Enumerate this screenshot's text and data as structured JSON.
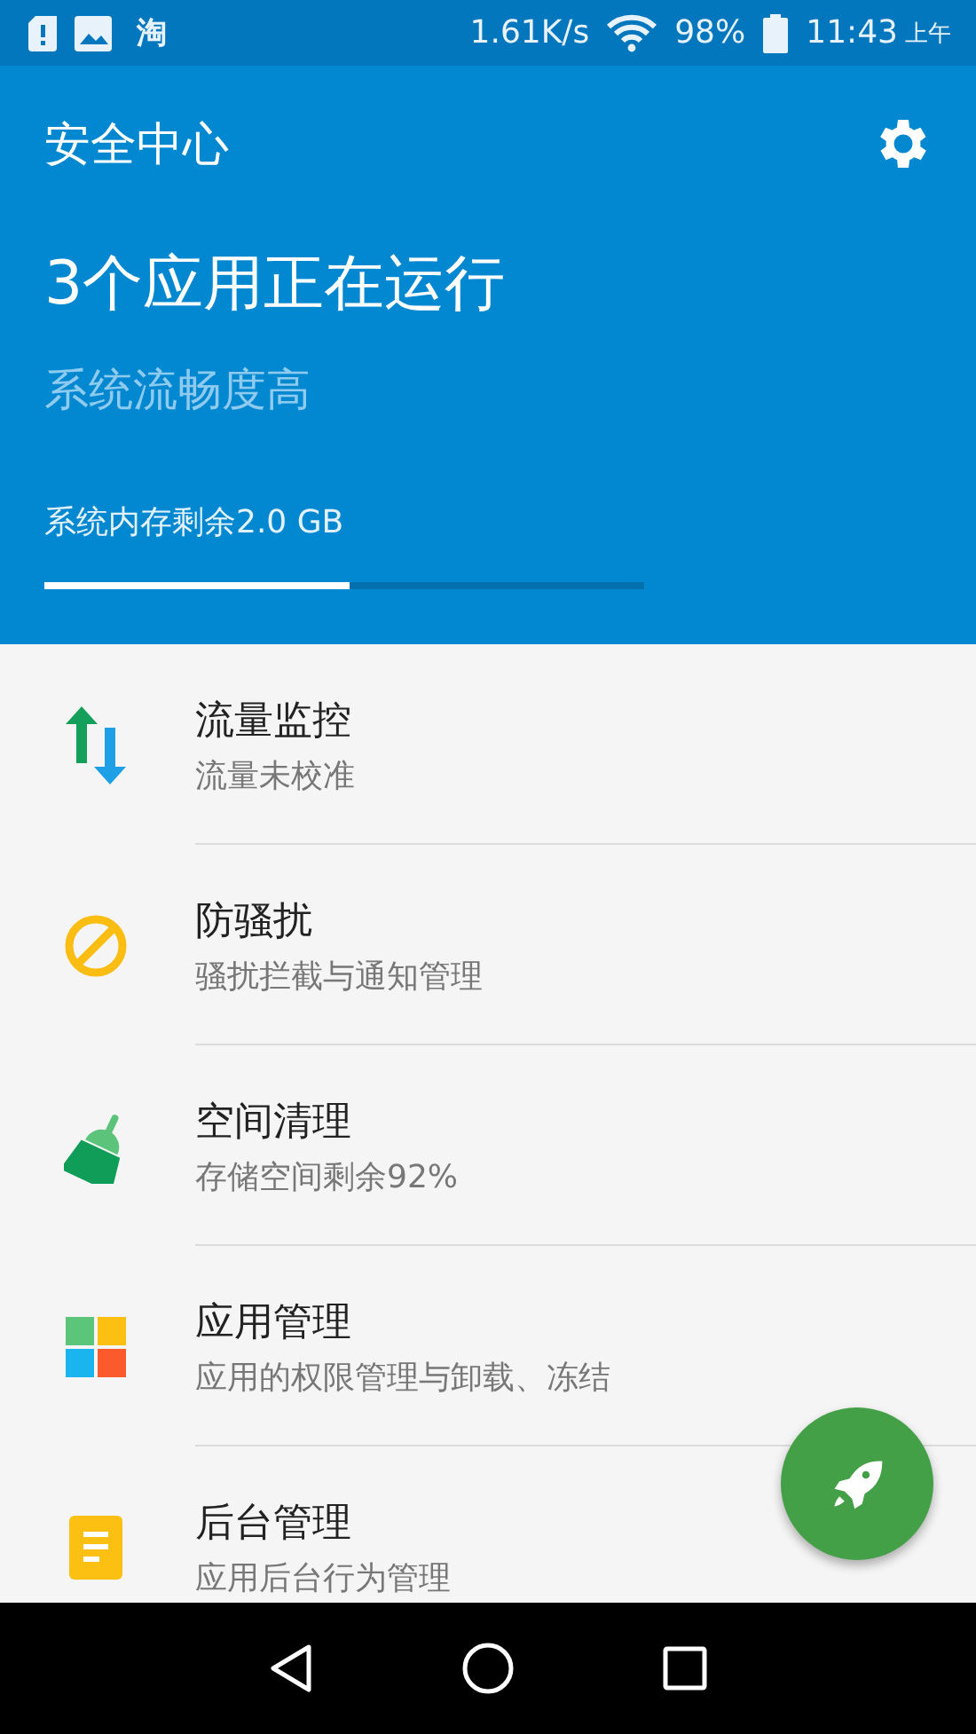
{
  "status_bar": {
    "app_label": "淘",
    "speed": "1.61K/s",
    "battery": "98%",
    "time": "11:43",
    "period": "上午"
  },
  "header": {
    "title": "安全中心",
    "headline": "3个应用正在运行",
    "status": "系统流畅度高",
    "memory_label": "系统内存剩余2.0 GB",
    "memory": {
      "level": 0.51
    }
  },
  "items": [
    {
      "kind": "traffic",
      "title": "流量监控",
      "subtitle": "流量未校准"
    },
    {
      "kind": "block",
      "title": "防骚扰",
      "subtitle": "骚扰拦截与通知管理"
    },
    {
      "kind": "broom",
      "title": "空间清理",
      "subtitle": "存储空间剩余92%"
    },
    {
      "kind": "grid",
      "title": "应用管理",
      "subtitle": "应用的权限管理与卸载、冻结"
    },
    {
      "kind": "doc",
      "title": "后台管理",
      "subtitle": "应用后台行为管理"
    }
  ]
}
